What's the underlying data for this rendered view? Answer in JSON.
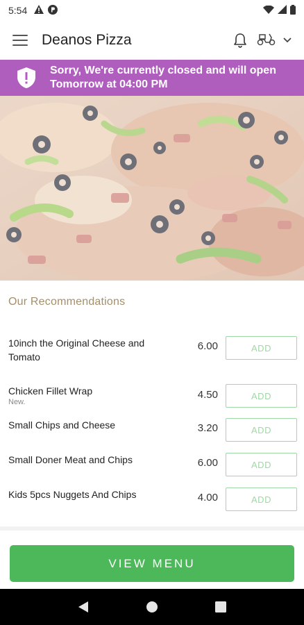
{
  "status_bar": {
    "time": "5:54",
    "icons": [
      "warning-icon",
      "p-badge-icon",
      "wifi-icon",
      "signal-icon",
      "battery-icon"
    ]
  },
  "app_bar": {
    "title": "Deanos Pizza",
    "icons": [
      "menu-icon",
      "bell-icon",
      "scooter-icon",
      "chevron-down-icon"
    ]
  },
  "closed_banner": {
    "line1": "Sorry, We're currently closed and will open",
    "line2": "Tomorrow at 04:00 PM",
    "color": "#b05ebd"
  },
  "recommendations": {
    "title": "Our Recommendations",
    "items": [
      {
        "name": "10inch the Original Cheese and Tomato",
        "sub": "",
        "price": "6.00",
        "add_label": "ADD"
      },
      {
        "name": "Chicken Fillet Wrap",
        "sub": "New.",
        "price": "4.50",
        "add_label": "ADD"
      },
      {
        "name": "Small Chips and Cheese",
        "sub": "",
        "price": "3.20",
        "add_label": "ADD"
      },
      {
        "name": "Small Doner Meat and Chips",
        "sub": "",
        "price": "6.00",
        "add_label": "ADD"
      },
      {
        "name": "Kids 5pcs Nuggets And Chips",
        "sub": "",
        "price": "4.00",
        "add_label": "ADD"
      }
    ]
  },
  "view_menu": {
    "label": "VIEW MENU",
    "color": "#4cb85a"
  },
  "nav_bar": {
    "icons": [
      "back-icon",
      "home-icon",
      "recents-icon"
    ]
  }
}
